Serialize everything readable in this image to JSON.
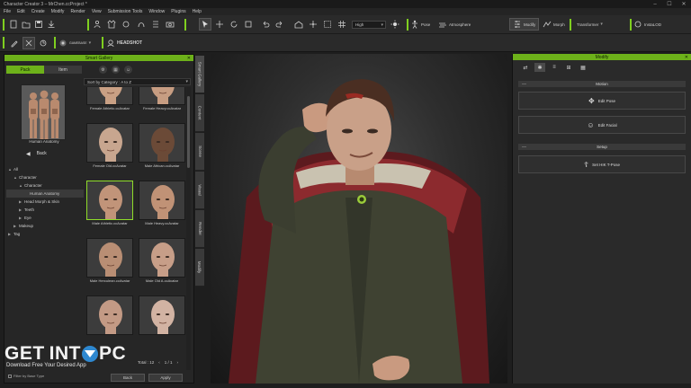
{
  "window": {
    "title": "Character Creator 3 – MrChen.ccProject *",
    "controls": [
      "–",
      "☐",
      "✕"
    ]
  },
  "menu": [
    "File",
    "Edit",
    "Create",
    "Modify",
    "Render",
    "View",
    "Submission Tools",
    "Window",
    "Plugins",
    "Help"
  ],
  "toolbar": {
    "quality": "High",
    "pose": "Pose",
    "atmosphere": "Atmosphere",
    "modify": "Modify",
    "morph": "Morph",
    "transformer": "Transformer",
    "iray": "InstaLOD",
    "headshot": "HEADSHOT",
    "gameBase": "GAMEBASE"
  },
  "smartGallery": {
    "title": "Smart Gallery",
    "tabs": [
      "Pack",
      "Item"
    ],
    "packName": "Human Anatomy",
    "back": "Back",
    "sort": "Sort by Category : A to Z",
    "tree": [
      {
        "label": "All",
        "indent": 0,
        "caret": "▲"
      },
      {
        "label": "Character",
        "indent": 1,
        "caret": "▲"
      },
      {
        "label": "Character",
        "indent": 2,
        "caret": "▲"
      },
      {
        "label": "Human Anatomy",
        "indent": 3,
        "caret": "",
        "selected": true
      },
      {
        "label": "Head Morph & Skin",
        "indent": 2,
        "caret": "▶"
      },
      {
        "label": "Teeth",
        "indent": 2,
        "caret": "▶"
      },
      {
        "label": "Eye",
        "indent": 2,
        "caret": "▶"
      },
      {
        "label": "Makeup",
        "indent": 1,
        "caret": "▶"
      },
      {
        "label": "Tag",
        "indent": 0,
        "caret": "▶"
      }
    ],
    "items": [
      {
        "label": "Female Athletic.ccAvatar",
        "skin": "#c9a084"
      },
      {
        "label": "Female Heavy.ccAvatar",
        "skin": "#c79d82"
      },
      {
        "label": "Female Old.ccAvatar",
        "skin": "#c8a68f"
      },
      {
        "label": "Male African.ccAvatar",
        "skin": "#6b4a37"
      },
      {
        "label": "Male Athletic.ccAvatar",
        "skin": "#c19479",
        "selected": true
      },
      {
        "label": "Male Heavy.ccAvatar",
        "skin": "#c09276"
      },
      {
        "label": "Male Herculean.ccAvatar",
        "skin": "#b98e74"
      },
      {
        "label": "Male Old A.ccAvatar",
        "skin": "#c79e88"
      },
      {
        "label": "",
        "skin": "#c39a85"
      },
      {
        "label": "",
        "skin": "#d2b3a3"
      }
    ],
    "total_label": "Total : 12",
    "page": "1 / 1",
    "buttons": {
      "back": "Back",
      "apply": "Apply"
    },
    "filter": "Filter by Base Type"
  },
  "verticalTabs": [
    "Smart Gallery",
    "Content",
    "Scene",
    "Visual",
    "Render",
    "Modify"
  ],
  "modifyPanel": {
    "title": "Modify",
    "sections": {
      "motion": "Motion",
      "setup": "Setup"
    },
    "buttons": {
      "editPose": "Edit Pose",
      "editFacial": "Edit Facial",
      "setTPose": "Set HIK T-Pose"
    }
  },
  "watermark": {
    "main_a": "GET",
    "main_b": "INT",
    "main_c": " PC",
    "sub": "Download Free Your Desired App"
  }
}
